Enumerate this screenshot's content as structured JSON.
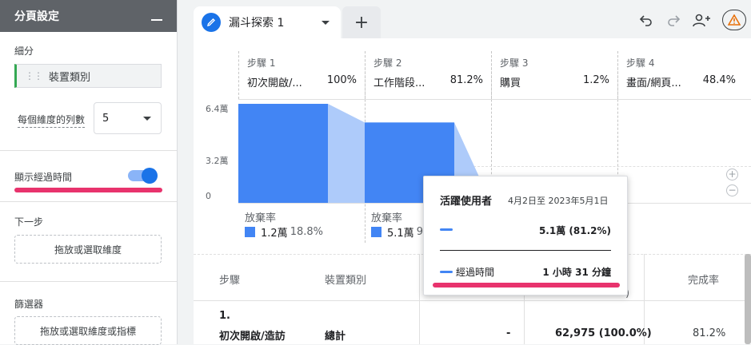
{
  "panel": {
    "title": "分頁設定",
    "breakdown_label": "細分",
    "breakdown_value": "裝置類別",
    "rows_label": "每個維度的列數",
    "rows_value": "5",
    "elapsed_label": "顯示經過時間",
    "elapsed_on": true,
    "next_step_label": "下一步",
    "next_step_drop": "拖放或選取維度",
    "filters_label": "篩選器",
    "filters_drop": "拖放或選取維度或指標"
  },
  "tabs": [
    {
      "label": "漏斗探索 1"
    }
  ],
  "toolbar": {
    "icons": [
      "undo-icon",
      "redo-icon",
      "share-user-icon",
      "warning-icon"
    ]
  },
  "steps": [
    {
      "num": "步驟 1",
      "name": "初次開啟/...",
      "pct": "100%"
    },
    {
      "num": "步驟 2",
      "name": "工作階段...",
      "pct": "81.2%"
    },
    {
      "num": "步驟 3",
      "name": "購買",
      "pct": "1.2%"
    },
    {
      "num": "步驟 4",
      "name": "畫面/網頁...",
      "pct": "48.4%"
    }
  ],
  "chart_data": {
    "type": "bar",
    "categories": [
      "步驟 1",
      "步驟 2",
      "步驟 3",
      "步驟 4"
    ],
    "values": [
      62975,
      51135,
      0,
      0
    ],
    "y_ticks": [
      "6.4萬",
      "3.2萬",
      "0"
    ],
    "ylim": [
      0,
      64000
    ]
  },
  "abandon": [
    {
      "label": "放棄率",
      "value": "1.2萬",
      "pct": "18.8%"
    },
    {
      "label": "放棄率",
      "value": "5.1萬",
      "pct": "9..."
    }
  ],
  "tooltip": {
    "title": "活躍使用者",
    "date_range": "4月2日至 2023年5月1日",
    "value": "5.1萬 (81.2%)",
    "elapsed_label": "經過時間",
    "elapsed_value": "1 小時 31 分鐘"
  },
  "table": {
    "headers": [
      "步驟",
      "裝置類別",
      "完成率"
    ],
    "row": {
      "step_num": "1.",
      "step_name": "初次開啟/造訪",
      "device": "總計",
      "col3": "-",
      "col4": "62,975 (100.0%)",
      "completion": "81.2%"
    }
  },
  "colors": {
    "accent": "#1a73e8",
    "bar": "#4285f4",
    "bar_light": "#aecbfa",
    "highlight": "#e8336d"
  }
}
